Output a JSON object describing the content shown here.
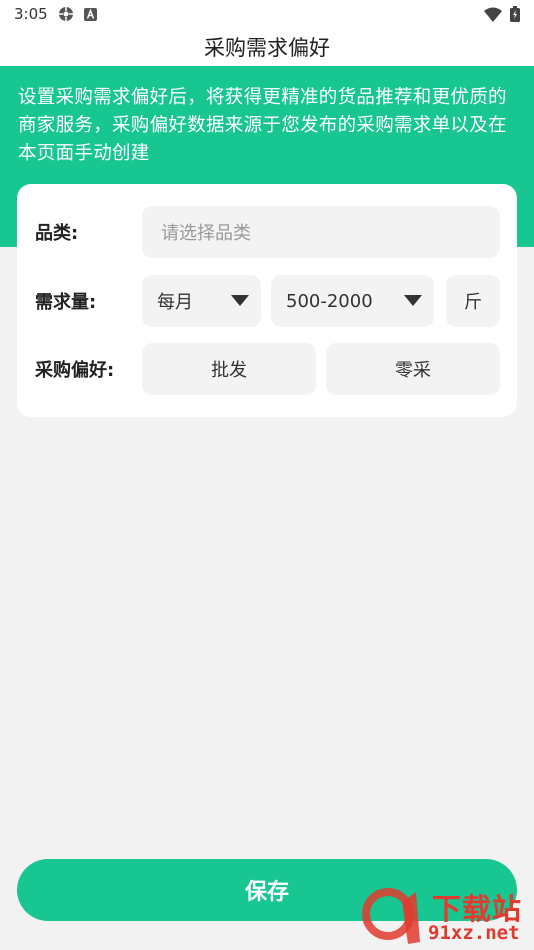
{
  "status_bar": {
    "time": "3:05",
    "left_icons": [
      "settings-gear-icon",
      "a-badge-icon"
    ],
    "right_icons": [
      "wifi-icon",
      "battery-icon"
    ]
  },
  "header": {
    "title": "采购需求偏好"
  },
  "banner": {
    "text": "设置采购需求偏好后，将获得更精准的货品推荐和更优质的商家服务，采购偏好数据来源于您发布的采购需求单以及在本页面手动创建",
    "bg_color": "#17c691"
  },
  "form": {
    "category": {
      "label": "品类:",
      "placeholder": "请选择品类"
    },
    "demand": {
      "label": "需求量:",
      "period": "每月",
      "range": "500-2000",
      "unit": "斤"
    },
    "preference": {
      "label": "采购偏好:",
      "options": [
        "批发",
        "零采"
      ]
    }
  },
  "save_button": {
    "label": "保存",
    "color": "#17c691"
  },
  "watermark": {
    "brand": "下载站",
    "domain": "91xz.net",
    "logo_text": "91",
    "color": "#e23a2e"
  }
}
